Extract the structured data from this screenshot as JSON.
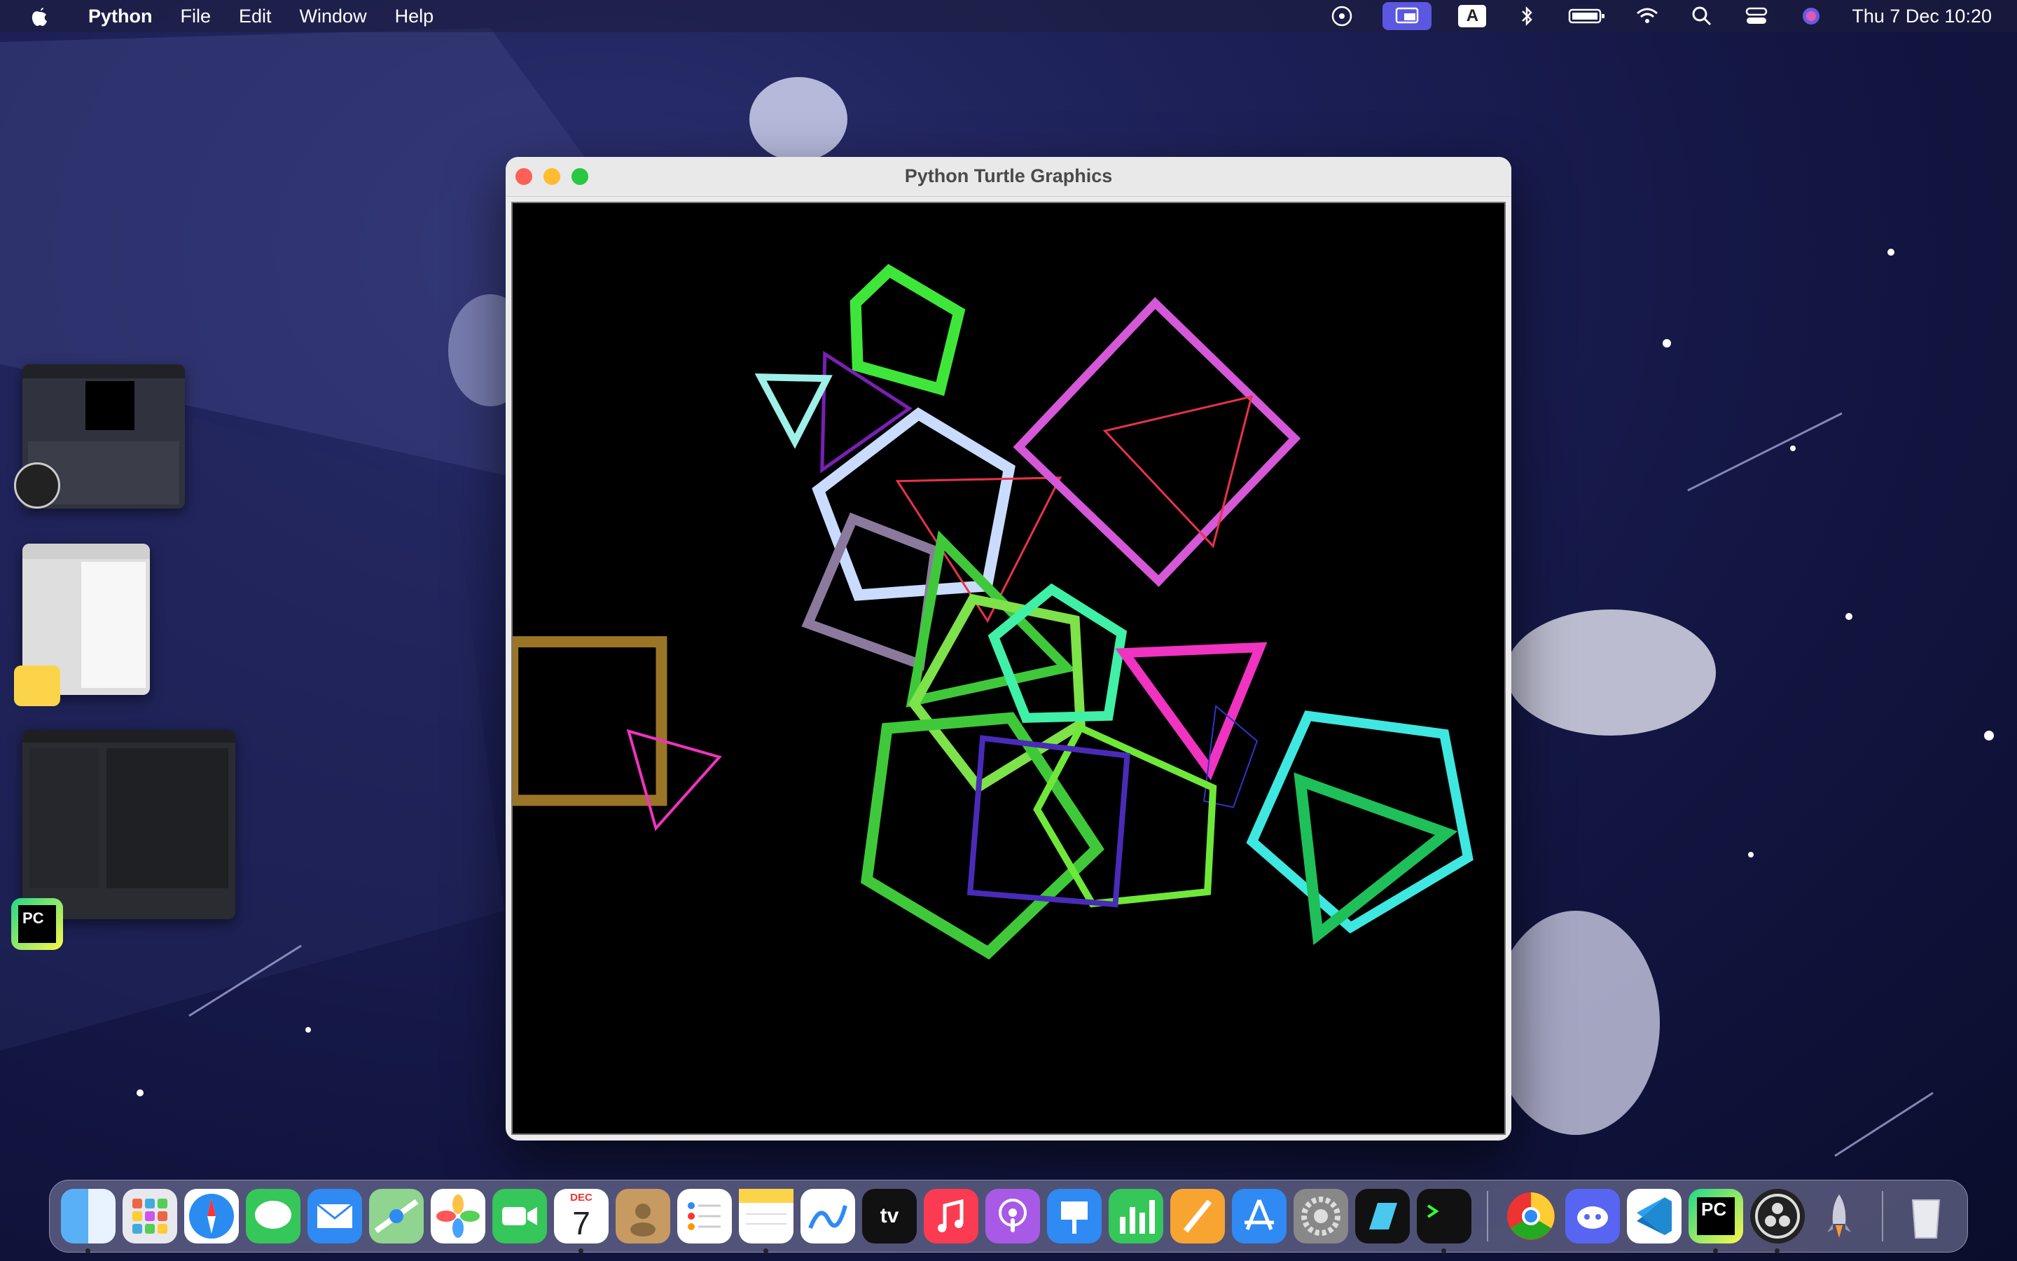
{
  "menubar": {
    "app_name": "Python",
    "menus": [
      "File",
      "Edit",
      "Window",
      "Help"
    ],
    "clock": "Thu 7 Dec  10:20",
    "keyboard_input": "A"
  },
  "window": {
    "title": "Python Turtle Graphics"
  },
  "dock": {
    "calendar_month": "DEC",
    "calendar_day": "7",
    "appletv_label": "tv",
    "pycharm_label": "PC",
    "apps": [
      "Finder",
      "Launchpad",
      "Safari",
      "Messages",
      "Mail",
      "Maps",
      "Photos",
      "FaceTime",
      "Calendar",
      "Contacts",
      "Reminders",
      "Notes",
      "Freeform",
      "TV",
      "Music",
      "Podcasts",
      "Keynote",
      "Numbers",
      "Pages",
      "App Store",
      "System Settings",
      "Screens",
      "Terminal",
      "Chrome",
      "Discord",
      "VS Code",
      "PyCharm",
      "OBS",
      "Rocket",
      "Trash"
    ]
  },
  "sidebar_thumbs": {
    "pycharm_label": "PC"
  }
}
